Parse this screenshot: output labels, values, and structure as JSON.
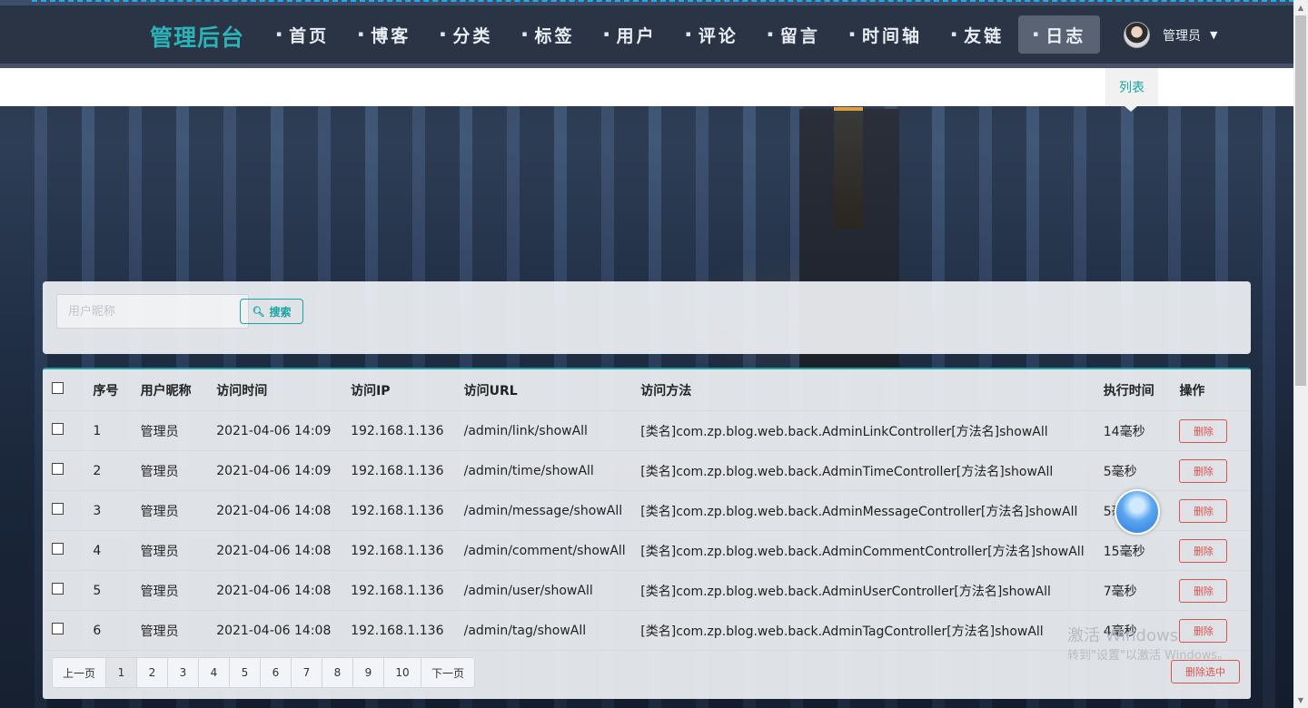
{
  "brand": "管理后台",
  "nav": [
    {
      "label": "首页"
    },
    {
      "label": "博客"
    },
    {
      "label": "分类"
    },
    {
      "label": "标签"
    },
    {
      "label": "用户"
    },
    {
      "label": "评论"
    },
    {
      "label": "留言"
    },
    {
      "label": "时间轴"
    },
    {
      "label": "友链"
    },
    {
      "label": "日志",
      "active": true
    }
  ],
  "user": {
    "name": "管理员"
  },
  "subnav": {
    "list_label": "列表"
  },
  "search": {
    "placeholder": "用户昵称",
    "button_label": "搜索"
  },
  "table": {
    "headers": [
      "序号",
      "用户昵称",
      "访问时间",
      "访问IP",
      "访问URL",
      "访问方法",
      "执行时间",
      "操作"
    ],
    "rows": [
      {
        "no": "1",
        "nickname": "管理员",
        "time": "2021-04-06 14:09",
        "ip": "192.168.1.136",
        "url": "/admin/link/showAll",
        "method": "[类名]com.zp.blog.web.back.AdminLinkController[方法名]showAll",
        "exec": "14毫秒"
      },
      {
        "no": "2",
        "nickname": "管理员",
        "time": "2021-04-06 14:09",
        "ip": "192.168.1.136",
        "url": "/admin/time/showAll",
        "method": "[类名]com.zp.blog.web.back.AdminTimeController[方法名]showAll",
        "exec": "5毫秒"
      },
      {
        "no": "3",
        "nickname": "管理员",
        "time": "2021-04-06 14:08",
        "ip": "192.168.1.136",
        "url": "/admin/message/showAll",
        "method": "[类名]com.zp.blog.web.back.AdminMessageController[方法名]showAll",
        "exec": "5毫秒"
      },
      {
        "no": "4",
        "nickname": "管理员",
        "time": "2021-04-06 14:08",
        "ip": "192.168.1.136",
        "url": "/admin/comment/showAll",
        "method": "[类名]com.zp.blog.web.back.AdminCommentController[方法名]showAll",
        "exec": "15毫秒"
      },
      {
        "no": "5",
        "nickname": "管理员",
        "time": "2021-04-06 14:08",
        "ip": "192.168.1.136",
        "url": "/admin/user/showAll",
        "method": "[类名]com.zp.blog.web.back.AdminUserController[方法名]showAll",
        "exec": "7毫秒"
      },
      {
        "no": "6",
        "nickname": "管理员",
        "time": "2021-04-06 14:08",
        "ip": "192.168.1.136",
        "url": "/admin/tag/showAll",
        "method": "[类名]com.zp.blog.web.back.AdminTagController[方法名]showAll",
        "exec": "4毫秒"
      }
    ],
    "delete_label": "删除"
  },
  "pagination": {
    "prev": "上一页",
    "pages": [
      "1",
      "2",
      "3",
      "4",
      "5",
      "6",
      "7",
      "8",
      "9",
      "10"
    ],
    "current": "1",
    "next": "下一页"
  },
  "bulk_delete_label": "删除选中",
  "watermark": {
    "line1": "激活 Windows",
    "line2": "转到\"设置\"以激活 Windows。"
  },
  "colors": {
    "accent": "#1aa3a3",
    "danger": "#d9534f",
    "navbar": "#28323f"
  }
}
